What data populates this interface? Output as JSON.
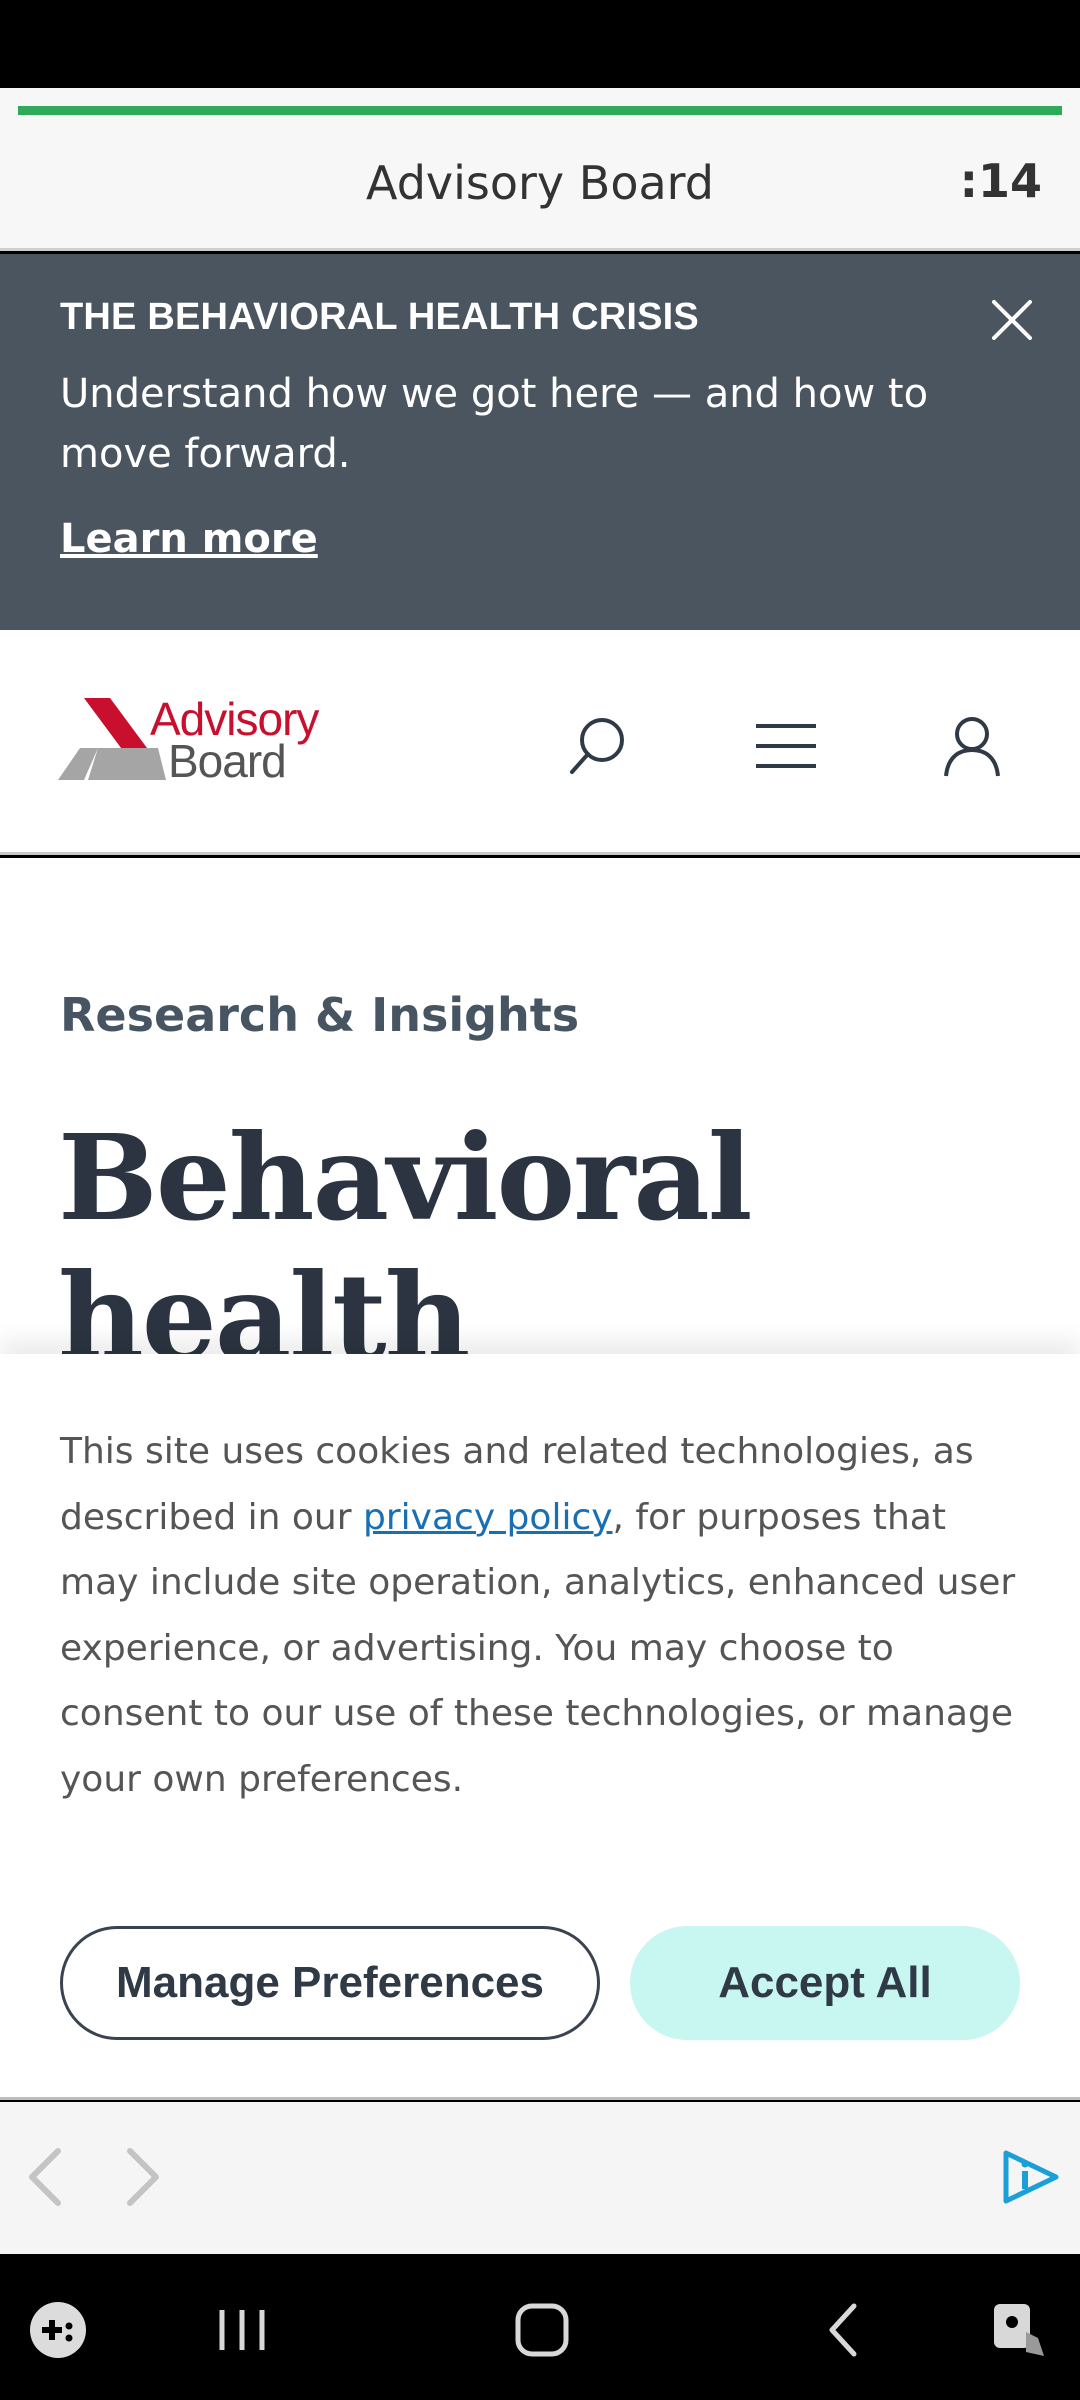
{
  "app_header": {
    "title": "Advisory Board",
    "timer": ":14",
    "progress_percent": 100,
    "progress_color": "#2faa5b"
  },
  "promo_banner": {
    "heading": "THE BEHAVIORAL HEALTH CRISIS",
    "body": "Understand how we got here — and how to move forward.",
    "link": "Learn more",
    "close_icon": "close-icon"
  },
  "site_nav": {
    "logo_line1": "Advisory",
    "logo_line2": "Board",
    "brand_red": "#c8102e",
    "icons": [
      "search-icon",
      "menu-icon",
      "user-icon"
    ]
  },
  "main": {
    "eyebrow": "Research & Insights",
    "title": "Behavioral health"
  },
  "cookie_banner": {
    "text_before": "This site uses cookies and related technologies, as described in our ",
    "link": "privacy policy",
    "text_after": ", for purposes that may include site operation, analytics, enhanced user experience, or advertising. You may choose to consent to our use of these technologies, or manage your own preferences.",
    "manage_button": "Manage Preferences",
    "accept_button": "Accept All",
    "accept_color": "#c8f6f1"
  },
  "browser_bar": {
    "icons": [
      "back-arrow-icon",
      "forward-arrow-icon",
      "info-play-icon"
    ]
  },
  "system_nav": {
    "icons": [
      "game-launcher-icon",
      "recents-icon",
      "home-icon",
      "back-icon",
      "accessibility-icon"
    ]
  }
}
